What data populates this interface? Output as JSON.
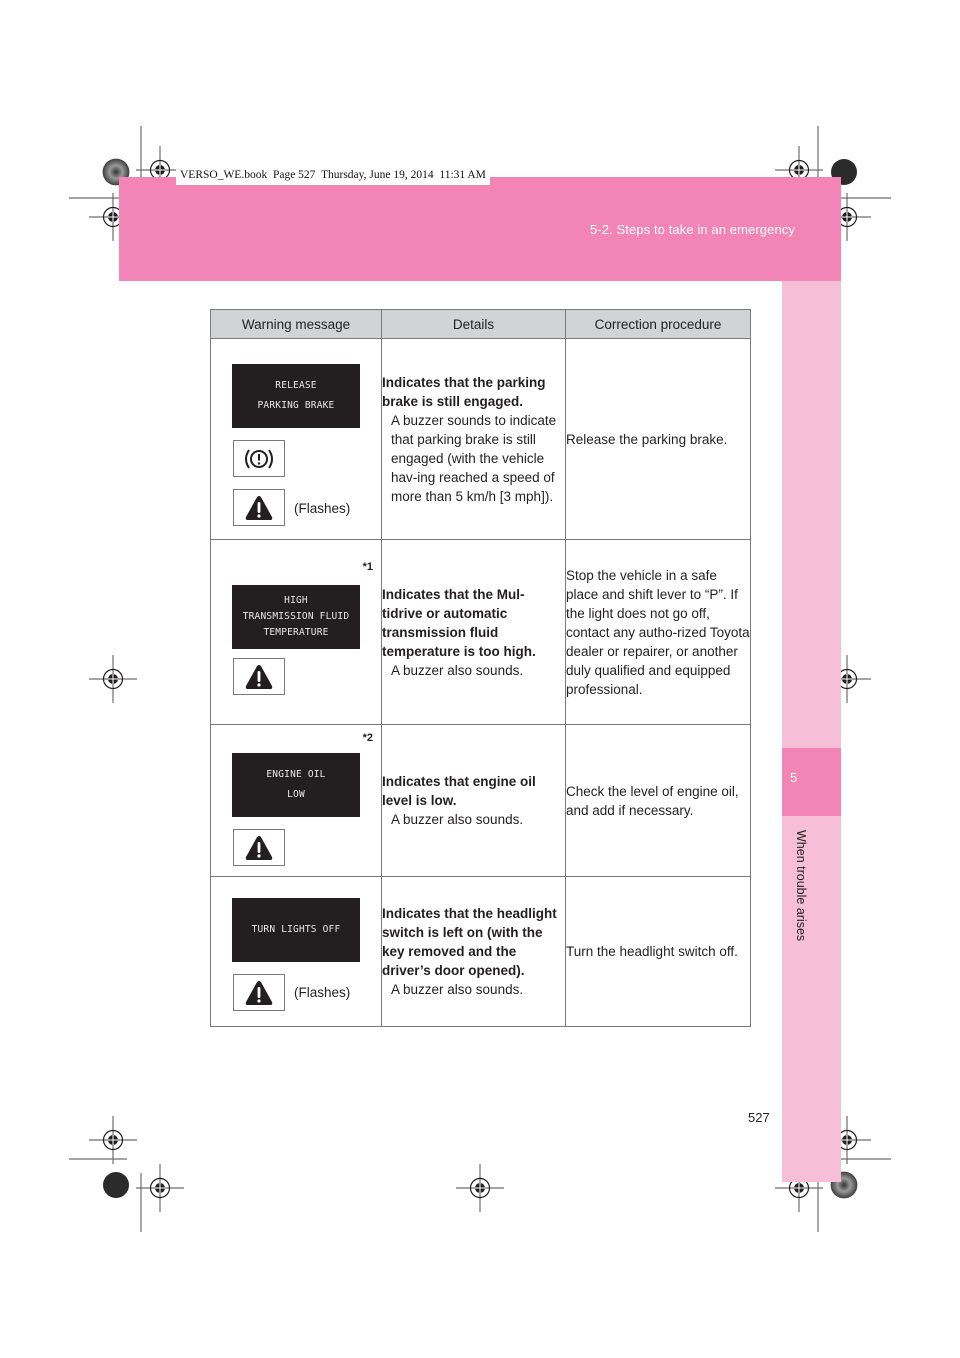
{
  "print_stamp": "VERSO_WE.book  Page 527  Thursday, June 19, 2014  11:31 AM",
  "header": {
    "section_title": "5-2. Steps to take in an emergency",
    "band_color": "#f285b5"
  },
  "side_tab": {
    "chapter_number": "5",
    "chapter_label": "When trouble arises",
    "tab_color": "#f285b5",
    "strip_color": "#f7bed8"
  },
  "page_number": "527",
  "table": {
    "columns": [
      "Warning message",
      "Details",
      "Correction procedure"
    ],
    "rows": [
      {
        "footnote": "",
        "display_lines": [
          "RELEASE",
          "PARKING BRAKE"
        ],
        "icons": [
          "brake-warning-icon",
          "master-warning-icon"
        ],
        "flashes_label": "(Flashes)",
        "details_bold": "Indicates that the parking brake is still engaged.",
        "details_text": "A buzzer sounds to indicate that parking brake is still engaged (with the vehicle hav-ing reached a speed of more than 5 km/h [3 mph]).",
        "correction": "Release the parking brake."
      },
      {
        "footnote": "*1",
        "display_lines": [
          "HIGH",
          "TRANSMISSION FLUID",
          "TEMPERATURE"
        ],
        "icons": [
          "master-warning-icon"
        ],
        "flashes_label": "",
        "details_bold": "Indicates that the Mul-tidrive or automatic transmission fluid temperature is too high.",
        "details_text": "A buzzer also sounds.",
        "correction": "Stop the vehicle in a safe place and shift lever to “P”. If the light does not go off, contact any autho-rized Toyota dealer or repairer, or another duly qualified and equipped professional."
      },
      {
        "footnote": "*2",
        "display_lines": [
          "ENGINE OIL",
          "LOW"
        ],
        "icons": [
          "master-warning-icon"
        ],
        "flashes_label": "",
        "details_bold": "Indicates that engine oil level is low.",
        "details_text": "A buzzer also sounds.",
        "correction": "Check the level of engine oil, and add if necessary."
      },
      {
        "footnote": "",
        "display_lines": [
          "TURN LIGHTS OFF"
        ],
        "icons": [
          "master-warning-icon"
        ],
        "flashes_label": "(Flashes)",
        "details_bold": "Indicates that the headlight switch is left on (with the key removed and the driver’s door opened).",
        "details_text": "A buzzer also sounds.",
        "correction": "Turn the headlight switch off."
      }
    ]
  }
}
